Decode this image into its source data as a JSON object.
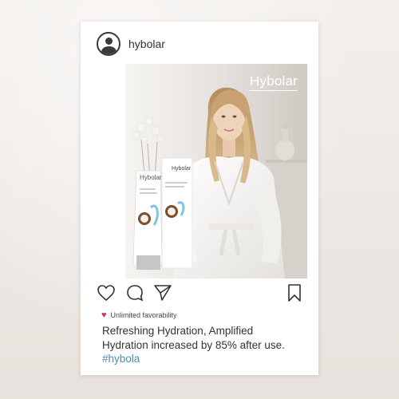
{
  "post": {
    "username": "hybolar",
    "brand_mark": "Hybolar",
    "favorability_label": "Unlimited favorability",
    "caption_line1": "Refreshing Hydration, Amplified",
    "caption_line2": "Hydration increased by 85% after use.",
    "hashtag": "#hybola"
  },
  "product": {
    "tube_brand": "Hybolar",
    "box_brand": "Hybolar"
  },
  "icons": {
    "profile": "user-circle-icon",
    "like": "heart-outline-icon",
    "comment": "comment-icon",
    "share": "send-icon",
    "save": "bookmark-icon",
    "favorability": "heart-filled-icon"
  },
  "colors": {
    "heart": "#c03565",
    "hashtag": "#4b8fb0",
    "text": "#333333"
  }
}
